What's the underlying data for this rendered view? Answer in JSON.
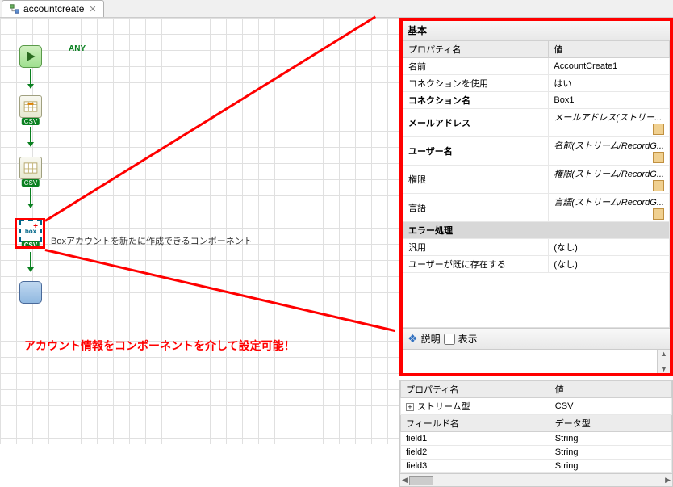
{
  "tab": {
    "title": "accountcreate"
  },
  "nodes": {
    "anyLabel": "ANY",
    "csvTag": "CSV",
    "boxLabel": "box"
  },
  "componentLabel": "Boxアカウントを新たに作成できるコンポーネント",
  "bottomText": "アカウント情報をコンポーネントを介して設定可能！",
  "panel": {
    "title": "基本",
    "headerProp": "プロパティ名",
    "headerVal": "値",
    "rows": [
      {
        "k": "名前",
        "v": "AccountCreate1"
      },
      {
        "k": "コネクションを使用",
        "v": "はい"
      },
      {
        "k": "コネクション名",
        "v": "Box1",
        "bold": true
      },
      {
        "k": "メールアドレス",
        "v": "メールアドレス(ストリー...",
        "bold": true,
        "italic": true,
        "picker": true
      },
      {
        "k": "ユーザー名",
        "v": "名前(ストリーム/RecordG...",
        "bold": true,
        "italic": true,
        "picker": true
      },
      {
        "k": "権限",
        "v": "権限(ストリーム/RecordG...",
        "italic": true,
        "picker": true
      },
      {
        "k": "言語",
        "v": "言語(ストリーム/RecordG...",
        "italic": true,
        "picker": true
      }
    ],
    "sectionError": "エラー処理",
    "errRows": [
      {
        "k": "汎用",
        "v": "(なし)"
      },
      {
        "k": "ユーザーが既に存在する",
        "v": "(なし)"
      }
    ],
    "descLabel": "説明",
    "showLabel": "表示"
  },
  "lower": {
    "headerProp": "プロパティ名",
    "headerVal": "値",
    "streamType": "ストリーム型",
    "streamVal": "CSV",
    "fieldName": "フィールド名",
    "dataType": "データ型",
    "fields": [
      {
        "name": "field1",
        "type": "String"
      },
      {
        "name": "field2",
        "type": "String"
      },
      {
        "name": "field3",
        "type": "String"
      }
    ]
  }
}
